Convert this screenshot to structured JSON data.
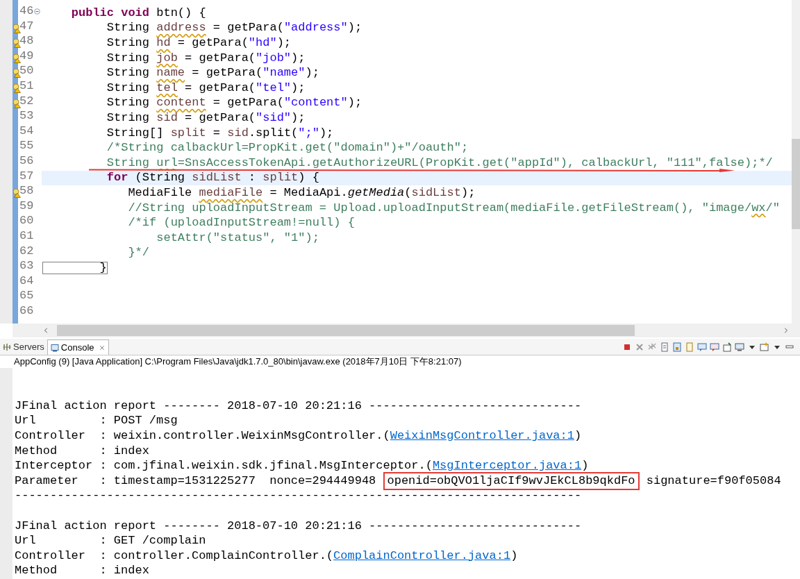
{
  "editor": {
    "lines": [
      {
        "number": "46",
        "fold": true,
        "warning": false,
        "current": false,
        "segments": [
          {
            "text": "    public void",
            "kind": "keyword"
          },
          {
            "text": " btn() {",
            "kind": "plain"
          }
        ]
      },
      {
        "number": "47",
        "fold": false,
        "warning": true,
        "current": false,
        "segments": [
          {
            "text": "         String ",
            "kind": "plain"
          },
          {
            "text": "address",
            "kind": "var_unused"
          },
          {
            "text": " = getPara(",
            "kind": "plain"
          },
          {
            "text": "\"address\"",
            "kind": "string"
          },
          {
            "text": ");",
            "kind": "plain"
          }
        ]
      },
      {
        "number": "48",
        "fold": false,
        "warning": true,
        "current": false,
        "segments": [
          {
            "text": "         String ",
            "kind": "plain"
          },
          {
            "text": "hd",
            "kind": "var_unused"
          },
          {
            "text": " = getPara(",
            "kind": "plain"
          },
          {
            "text": "\"hd\"",
            "kind": "string"
          },
          {
            "text": ");",
            "kind": "plain"
          }
        ]
      },
      {
        "number": "49",
        "fold": false,
        "warning": true,
        "current": false,
        "segments": [
          {
            "text": "         String ",
            "kind": "plain"
          },
          {
            "text": "job",
            "kind": "var_unused"
          },
          {
            "text": " = getPara(",
            "kind": "plain"
          },
          {
            "text": "\"job\"",
            "kind": "string"
          },
          {
            "text": ");",
            "kind": "plain"
          }
        ]
      },
      {
        "number": "50",
        "fold": false,
        "warning": true,
        "current": false,
        "segments": [
          {
            "text": "         String ",
            "kind": "plain"
          },
          {
            "text": "name",
            "kind": "var_unused"
          },
          {
            "text": " = getPara(",
            "kind": "plain"
          },
          {
            "text": "\"name\"",
            "kind": "string"
          },
          {
            "text": ");",
            "kind": "plain"
          }
        ]
      },
      {
        "number": "51",
        "fold": false,
        "warning": true,
        "current": false,
        "segments": [
          {
            "text": "         String ",
            "kind": "plain"
          },
          {
            "text": "tel",
            "kind": "var_unused"
          },
          {
            "text": " = getPara(",
            "kind": "plain"
          },
          {
            "text": "\"tel\"",
            "kind": "string"
          },
          {
            "text": ");",
            "kind": "plain"
          }
        ]
      },
      {
        "number": "52",
        "fold": false,
        "warning": true,
        "current": false,
        "segments": [
          {
            "text": "         String ",
            "kind": "plain"
          },
          {
            "text": "content",
            "kind": "var_unused"
          },
          {
            "text": " = getPara(",
            "kind": "plain"
          },
          {
            "text": "\"content\"",
            "kind": "string"
          },
          {
            "text": ");",
            "kind": "plain"
          }
        ]
      },
      {
        "number": "53",
        "fold": false,
        "warning": false,
        "current": false,
        "segments": [
          {
            "text": "         String ",
            "kind": "plain"
          },
          {
            "text": "sid",
            "kind": "var"
          },
          {
            "text": " = getPara(",
            "kind": "plain"
          },
          {
            "text": "\"sid\"",
            "kind": "string"
          },
          {
            "text": ");",
            "kind": "plain"
          }
        ]
      },
      {
        "number": "54",
        "fold": false,
        "warning": false,
        "current": false,
        "segments": [
          {
            "text": "         String[] ",
            "kind": "plain"
          },
          {
            "text": "split",
            "kind": "var"
          },
          {
            "text": " = ",
            "kind": "plain"
          },
          {
            "text": "sid",
            "kind": "var"
          },
          {
            "text": ".split(",
            "kind": "plain"
          },
          {
            "text": "\";\"",
            "kind": "string"
          },
          {
            "text": ");",
            "kind": "plain"
          }
        ]
      },
      {
        "number": "55",
        "fold": false,
        "warning": false,
        "current": false,
        "segments": [
          {
            "text": "         /*String calbackUrl=PropKit.get(\"domain\")+\"/oauth\";",
            "kind": "comment"
          }
        ]
      },
      {
        "number": "56",
        "fold": false,
        "warning": false,
        "current": false,
        "segments": [
          {
            "text": "         String ",
            "kind": "comment"
          },
          {
            "text": "url",
            "kind": "comment_flagged"
          },
          {
            "text": "=SnsAccessTokenApi.getAuthorizeURL(PropKit.get(\"appId\"), calbackUrl, \"111\",false);*/",
            "kind": "comment"
          }
        ]
      },
      {
        "number": "57",
        "fold": false,
        "warning": false,
        "current": true,
        "segments": [
          {
            "text": "         for",
            "kind": "keyword"
          },
          {
            "text": " (String ",
            "kind": "plain"
          },
          {
            "text": "sidList",
            "kind": "var"
          },
          {
            "text": " : ",
            "kind": "plain"
          },
          {
            "text": "split",
            "kind": "var"
          },
          {
            "text": ") {",
            "kind": "plain"
          }
        ]
      },
      {
        "number": "58",
        "fold": false,
        "warning": true,
        "current": false,
        "segments": [
          {
            "text": "            MediaFile ",
            "kind": "plain"
          },
          {
            "text": "mediaFile",
            "kind": "var_unused"
          },
          {
            "text": " = MediaApi.",
            "kind": "plain"
          },
          {
            "text": "getMedia",
            "kind": "static_call"
          },
          {
            "text": "(",
            "kind": "plain"
          },
          {
            "text": "sidList",
            "kind": "var"
          },
          {
            "text": ");",
            "kind": "plain"
          }
        ]
      },
      {
        "number": "59",
        "fold": false,
        "warning": false,
        "current": false,
        "segments": [
          {
            "text": "            //String uploadInputStream = Upload.uploadInputStream(mediaFile.getFileStream(), \"image/",
            "kind": "comment"
          },
          {
            "text": "wx",
            "kind": "comment_flagged"
          },
          {
            "text": "/\"",
            "kind": "comment"
          }
        ]
      },
      {
        "number": "60",
        "fold": false,
        "warning": false,
        "current": false,
        "segments": [
          {
            "text": "            /*if (uploadInputStream!=null) {",
            "kind": "comment"
          }
        ]
      },
      {
        "number": "61",
        "fold": false,
        "warning": false,
        "current": false,
        "segments": [
          {
            "text": "                setAttr(\"status\", \"1\");",
            "kind": "comment"
          }
        ]
      },
      {
        "number": "62",
        "fold": false,
        "warning": false,
        "current": false,
        "segments": [
          {
            "text": "            }*/",
            "kind": "comment"
          }
        ]
      },
      {
        "number": "63",
        "fold": false,
        "warning": false,
        "current": false,
        "segments": [
          {
            "text": "        }",
            "kind": "bracket_match"
          }
        ]
      },
      {
        "number": "64",
        "fold": false,
        "warning": false,
        "current": false
      },
      {
        "number": "65",
        "fold": false,
        "warning": false,
        "current": false
      },
      {
        "number": "66",
        "fold": false,
        "warning": false,
        "current": false
      }
    ]
  },
  "console": {
    "tabs": [
      {
        "label": "Servers",
        "selected": false,
        "kind": "servers"
      },
      {
        "label": "Console",
        "selected": true,
        "kind": "console"
      }
    ],
    "description": "AppConfig (9) [Java Application] C:\\Program Files\\Java\\jdk1.7.0_80\\bin\\javaw.exe (2018年7月10日 下午8:21:07)",
    "reports": [
      {
        "lines": [
          [
            {
              "text": "JFinal action report -------- 2018-07-10 20:21:16 ------------------------------",
              "kind": "text"
            }
          ],
          [
            {
              "text": "Url         : POST /msg",
              "kind": "text"
            }
          ],
          [
            {
              "text": "Controller  : weixin.controller.WeixinMsgController.(",
              "kind": "text"
            },
            {
              "text": "WeixinMsgController.java:1",
              "kind": "link"
            },
            {
              "text": ")",
              "kind": "text"
            }
          ],
          [
            {
              "text": "Method      : index",
              "kind": "text"
            }
          ],
          [
            {
              "text": "Interceptor : com.jfinal.weixin.sdk.jfinal.MsgInterceptor.(",
              "kind": "text"
            },
            {
              "text": "MsgInterceptor.java:1",
              "kind": "link"
            },
            {
              "text": ")",
              "kind": "text"
            }
          ],
          [
            {
              "text": "Parameter   : timestamp=1531225277  nonce=294449948 ",
              "kind": "text"
            },
            {
              "text": "openid=obQVO1ljaCIf9wvJEkCL8b9qkdFo",
              "kind": "boxed"
            },
            {
              "text": " signature=f90f05084",
              "kind": "text"
            }
          ],
          [
            {
              "text": "--------------------------------------------------------------------------------",
              "kind": "text"
            }
          ]
        ]
      },
      {
        "lines": [
          [
            {
              "text": "JFinal action report -------- 2018-07-10 20:21:16 ------------------------------",
              "kind": "text"
            }
          ],
          [
            {
              "text": "Url         : GET /complain",
              "kind": "text"
            }
          ],
          [
            {
              "text": "Controller  : controller.ComplainController.(",
              "kind": "text"
            },
            {
              "text": "ComplainController.java:1",
              "kind": "link"
            },
            {
              "text": ")",
              "kind": "text"
            }
          ],
          [
            {
              "text": "Method      : index",
              "kind": "text"
            }
          ]
        ]
      }
    ]
  }
}
